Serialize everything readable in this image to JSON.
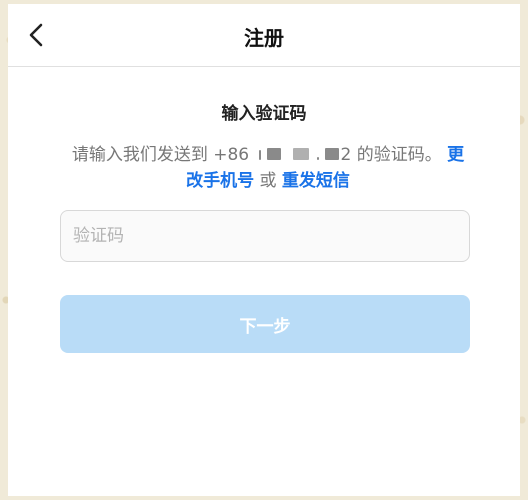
{
  "nav": {
    "back_icon": "chevron-left-icon",
    "title": "注册"
  },
  "heading": "输入验证码",
  "description": {
    "prefix": "请输入我们发送到 +86",
    "phone_masked_tail": "2",
    "suffix": "的验证码。",
    "change_phone_link": "更改手机号",
    "or_text": "或",
    "resend_link": "重发短信"
  },
  "code_input": {
    "placeholder": "验证码",
    "value": ""
  },
  "next_button": {
    "label": "下一步",
    "enabled": false
  },
  "colors": {
    "link": "#1a73e8",
    "button_disabled": "#b9dcf7",
    "border": "#d8d8d8"
  }
}
